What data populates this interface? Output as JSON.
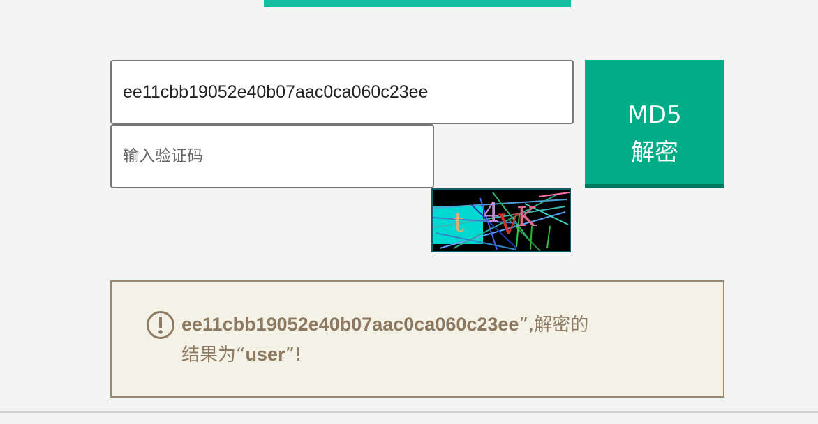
{
  "form": {
    "hash_value": "ee11cbb19052e40b07aac0ca060c23ee",
    "captcha_placeholder": "输入验证码",
    "decrypt_button": {
      "line1": "MD5",
      "line2": "解密"
    }
  },
  "captcha": {
    "text": "t4VK",
    "char_colors": [
      "#d6b46e",
      "#c08cd5",
      "#d33030",
      "#e06b8a"
    ]
  },
  "result": {
    "hash": "ee11cbb19052e40b07aac0ca060c23ee",
    "after_hash": "”,解密的",
    "line2_prefix": "结果为“",
    "plaintext": "user",
    "line2_suffix": "”!"
  },
  "colors": {
    "accent": "#14bfa1",
    "button": "#00ad87",
    "button_shadow": "#00765f",
    "result_border": "#998872",
    "result_bg": "#f4f2e7",
    "result_text": "#8f7b63"
  }
}
